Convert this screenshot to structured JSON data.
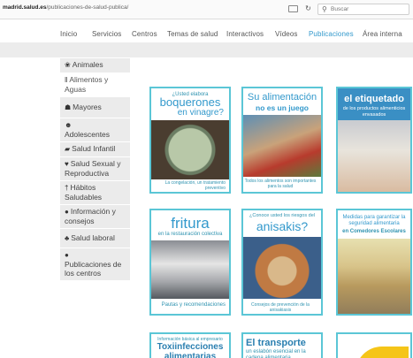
{
  "browser": {
    "url_host": "madrid.salud.es",
    "url_path": "/publicaciones-de-salud-publica/",
    "search_placeholder": "Buscar"
  },
  "nav": [
    {
      "label": "Inicio",
      "active": false
    },
    {
      "label": "Servicios",
      "active": false
    },
    {
      "label": "Centros",
      "active": false
    },
    {
      "label": "Temas de salud",
      "active": false
    },
    {
      "label": "Interactivos",
      "active": false
    },
    {
      "label": "Vídeos",
      "active": false
    },
    {
      "label": "Publicaciones",
      "active": true
    },
    {
      "label": "Área interna",
      "active": false
    }
  ],
  "sidebar": [
    {
      "icon": "paw-icon",
      "glyph": "❀",
      "label": "Animales"
    },
    {
      "icon": "fork-knife-icon",
      "glyph": "ǁ",
      "label": "Alimentos y Aguas"
    },
    {
      "icon": "person-icon",
      "glyph": "☗",
      "label": "Mayores"
    },
    {
      "icon": "users-icon",
      "glyph": "☻",
      "label": "Adolescentes"
    },
    {
      "icon": "baby-carriage-icon",
      "glyph": "▰",
      "label": "Salud Infantil"
    },
    {
      "icon": "venus-mars-icon",
      "glyph": "♥",
      "label": "Salud Sexual y Reproductiva"
    },
    {
      "icon": "walking-icon",
      "glyph": "†",
      "label": "Hábitos Saludables"
    },
    {
      "icon": "info-icon",
      "glyph": "●",
      "label": "Información y consejos"
    },
    {
      "icon": "briefcase-icon",
      "glyph": "♣",
      "label": "Salud laboral"
    },
    {
      "icon": "chat-icon",
      "glyph": "●",
      "label": "Publicaciones de los centros"
    }
  ],
  "covers": [
    {
      "kicker": "¿Usted elabora",
      "title": "boquerones",
      "subtitle": "en vinagre?",
      "foot": "La congelación, un tratamiento preventivo"
    },
    {
      "kicker": "",
      "title": "Su alimentación",
      "subtitle": "no es un juego",
      "foot": "Todos los alimentos son importantes para la salud"
    },
    {
      "kicker": "",
      "title": "el etiquetado",
      "subtitle": "de los productos alimenticios envasados",
      "foot": ""
    },
    {
      "kicker": "",
      "title": "fritura",
      "subtitle": "en la restauración colectiva",
      "foot": "Pautas y recomendaciones"
    },
    {
      "kicker": "¿Conoce usted los riesgos del",
      "title": "anisakis?",
      "subtitle": "",
      "foot": "Consejos de prevención de la anisakiasis"
    },
    {
      "kicker": "",
      "title": "Medidas para garantizar la seguridad alimentaria",
      "subtitle": "en Comedores Escolares",
      "foot": ""
    },
    {
      "kicker": "Información básica al empresario",
      "title": "Toxiinfecciones alimentarias",
      "subtitle": "",
      "foot": ""
    },
    {
      "kicker": "",
      "title": "El transporte",
      "subtitle": "un eslabón esencial en la cadena alimentaria",
      "foot": ""
    },
    {
      "kicker": "",
      "title": "",
      "subtitle": "",
      "foot": ""
    }
  ],
  "colors": {
    "accent": "#3399cc",
    "cover_border": "#5bc6d6",
    "sidebar_bg": "#ebebeb"
  }
}
